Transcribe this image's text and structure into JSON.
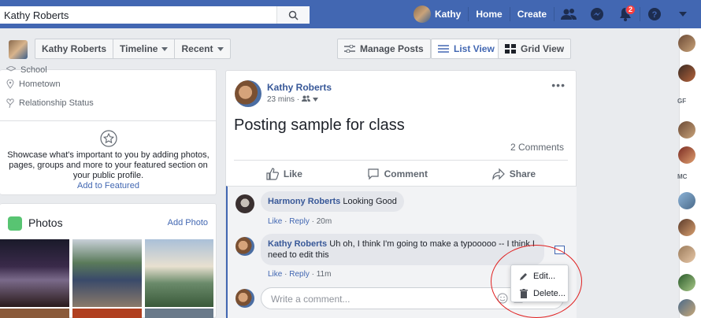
{
  "topbar": {
    "search_value": "Kathy Roberts",
    "user_name": "Kathy",
    "nav_home": "Home",
    "nav_create": "Create",
    "notification_count": "2",
    "brand_color": "#4267b2"
  },
  "profile_bar": {
    "name": "Kathy Roberts",
    "timeline": "Timeline",
    "recent": "Recent",
    "manage_posts": "Manage Posts",
    "list_view": "List View",
    "grid_view": "Grid View"
  },
  "intro": {
    "school": "School",
    "hometown": "Hometown",
    "relationship": "Relationship Status",
    "featured_text": "Showcase what's important to you by adding photos, pages, groups and more to your featured section on your public profile.",
    "featured_link": "Add to Featured"
  },
  "photos": {
    "title": "Photos",
    "add": "Add Photo"
  },
  "post": {
    "author": "Kathy Roberts",
    "time": "23 mins",
    "text": "Posting sample for class",
    "comment_count": "2 Comments",
    "like": "Like",
    "comment": "Comment",
    "share": "Share",
    "more": "•••"
  },
  "comments": [
    {
      "author": "Harmony Roberts",
      "text": "Looking Good",
      "like": "Like",
      "reply": "Reply",
      "time": "20m"
    },
    {
      "author": "Kathy Roberts",
      "text": "Uh oh, I think I'm going to make a typooooo -- I think I need to edit this",
      "like": "Like",
      "reply": "Reply",
      "time": "11m"
    }
  ],
  "comment_input": {
    "placeholder": "Write a comment..."
  },
  "menu": {
    "edit": "Edit...",
    "delete": "Delete..."
  },
  "right_rail": {
    "label_1": "GF",
    "label_2": "MC"
  }
}
